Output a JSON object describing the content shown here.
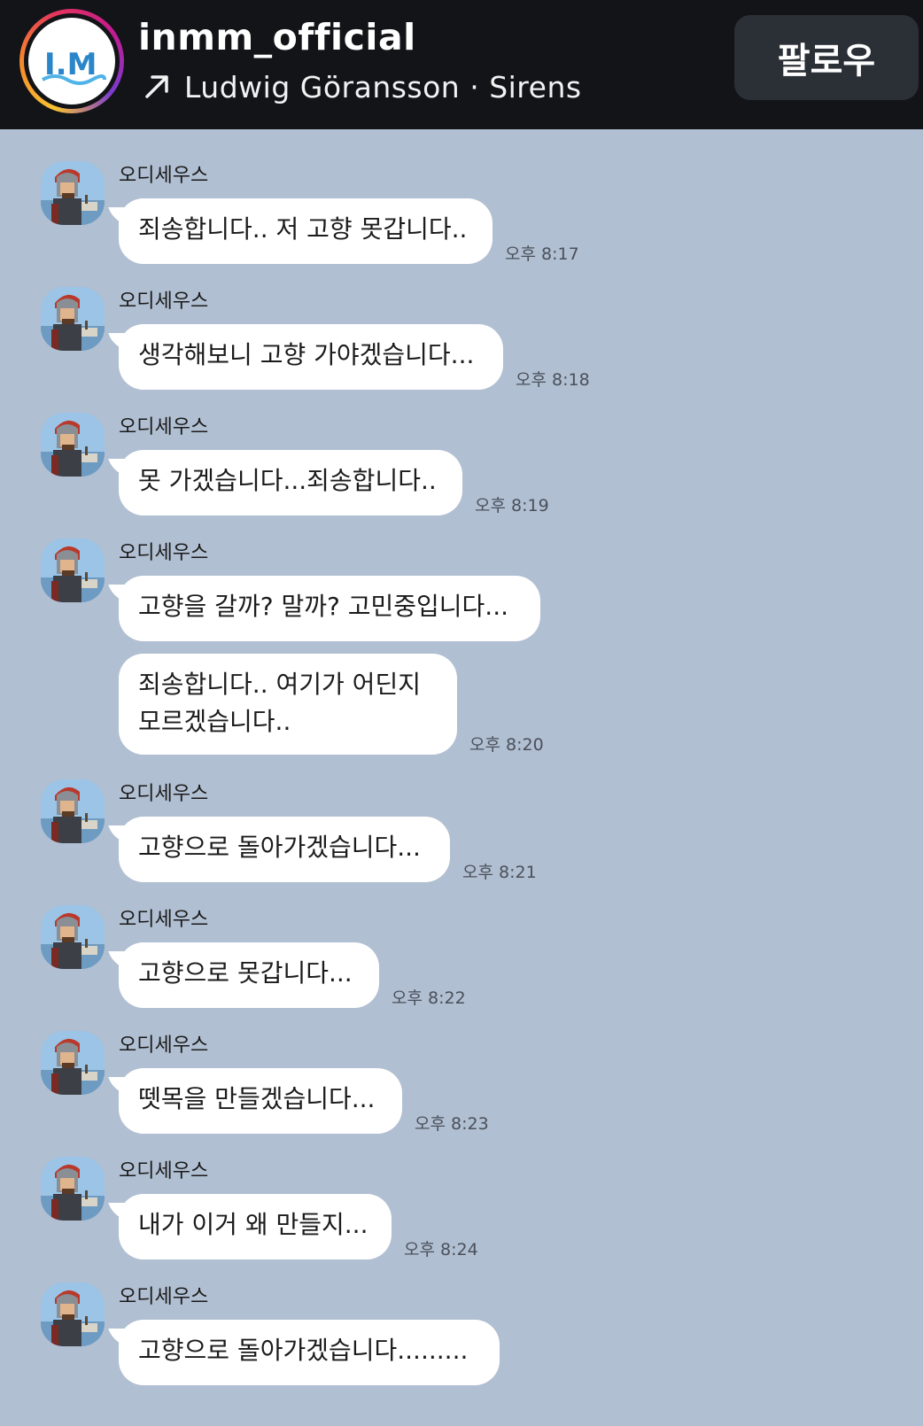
{
  "header": {
    "account_name": "inmm_official",
    "music_text": "Ludwig Göransson · Sirens",
    "follow_label": "팔로우",
    "logo_text": "I.M"
  },
  "colors": {
    "chat_background": "#b1bfd2",
    "header_background": "#121418",
    "bubble": "#ffffff",
    "follow_button": "#2b2f36"
  },
  "messages": [
    {
      "sender": "오디세우스",
      "text": "죄송합니다.. 저 고향 못갑니다..",
      "time": "오후 8:17"
    },
    {
      "sender": "오디세우스",
      "text": "생각해보니 고향 가야겠습니다...",
      "time": "오후 8:18"
    },
    {
      "sender": "오디세우스",
      "text": "못 가겠습니다...죄송합니다..",
      "time": "오후 8:19"
    },
    {
      "sender": "오디세우스",
      "text": "고향을 갈까? 말까? 고민중입니다...",
      "time": ""
    },
    {
      "sender": "",
      "text": "죄송합니다.. 여기가 어딘지\n모르겠습니다..",
      "time": "오후 8:20"
    },
    {
      "sender": "오디세우스",
      "text": "고향으로 돌아가겠습니다...",
      "time": "오후 8:21"
    },
    {
      "sender": "오디세우스",
      "text": "고향으로 못갑니다...",
      "time": "오후 8:22"
    },
    {
      "sender": "오디세우스",
      "text": "뗏목을 만들겠습니다...",
      "time": "오후 8:23"
    },
    {
      "sender": "오디세우스",
      "text": "내가 이거 왜 만들지...",
      "time": "오후 8:24"
    },
    {
      "sender": "오디세우스",
      "text": "고향으로 돌아가겠습니다.........",
      "time": ""
    }
  ]
}
